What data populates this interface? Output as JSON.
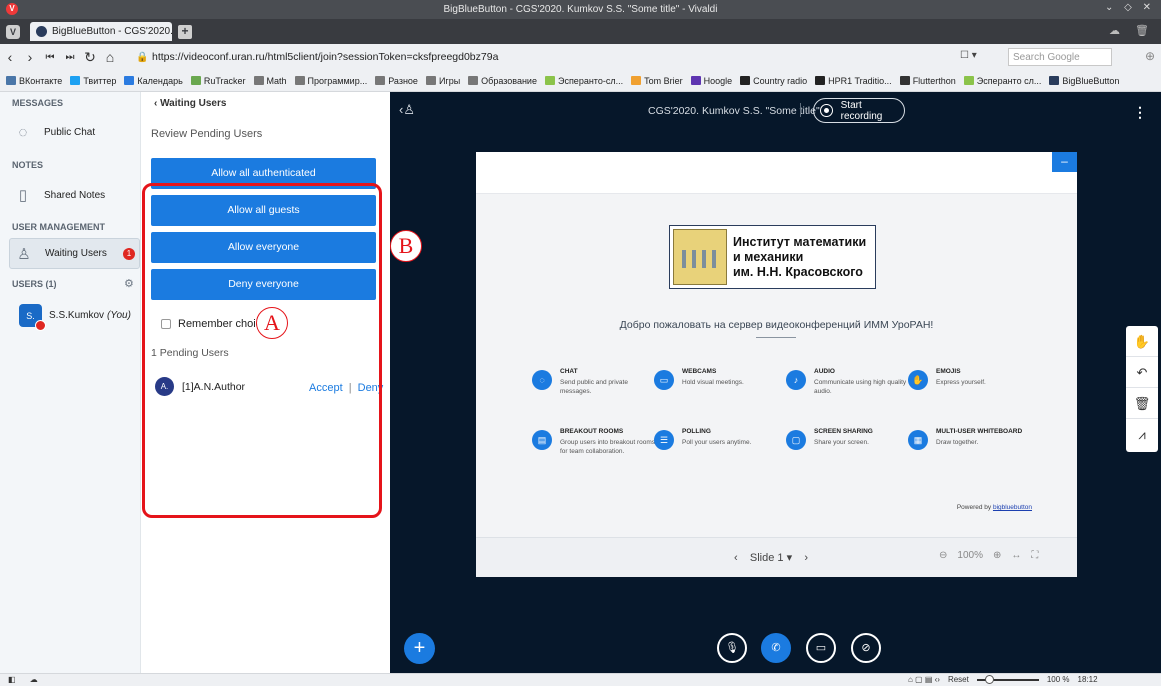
{
  "window": {
    "title": "BigBlueButton - CGS'2020. Kumkov S.S. \"Some title\" - Vivaldi"
  },
  "tab": {
    "label": "BigBlueButton - CGS'2020."
  },
  "address": {
    "url": "https://videoconf.uran.ru/html5client/join?sessionToken=cksfpreegd0bz79a",
    "search_placeholder": "Search Google"
  },
  "bookmarks": [
    {
      "label": "ВКонтакте",
      "color": "#4a76a8"
    },
    {
      "label": "Твиттер",
      "color": "#1da1f2"
    },
    {
      "label": "Календарь",
      "color": "#2b7be0"
    },
    {
      "label": "RuTracker",
      "color": "#6aa84f"
    },
    {
      "label": "Math",
      "color": "#777777"
    },
    {
      "label": "Программир...",
      "color": "#777777"
    },
    {
      "label": "Разное",
      "color": "#777777"
    },
    {
      "label": "Игры",
      "color": "#777777"
    },
    {
      "label": "Образование",
      "color": "#777777"
    },
    {
      "label": "Эсперанто-сл...",
      "color": "#8bc34a"
    },
    {
      "label": "Tom Brier",
      "color": "#f0a030"
    },
    {
      "label": "Hoogle",
      "color": "#5e35b1"
    },
    {
      "label": "Country radio",
      "color": "#222222"
    },
    {
      "label": "HPR1 Traditio...",
      "color": "#222222"
    },
    {
      "label": "Flutterthon",
      "color": "#333333"
    },
    {
      "label": "Эсперанто сл...",
      "color": "#8bc34a"
    },
    {
      "label": "BigBlueButton",
      "color": "#2a3c5c"
    }
  ],
  "sidebar": {
    "messages_heading": "MESSAGES",
    "public_chat": "Public Chat",
    "notes_heading": "NOTES",
    "shared_notes": "Shared Notes",
    "user_mgmt_heading": "USER MANAGEMENT",
    "waiting_users": "Waiting Users",
    "waiting_badge": "1",
    "users_heading": "USERS (1)",
    "user": {
      "initials": "S.",
      "name": "S.S.Kumkov",
      "you": "(You)"
    }
  },
  "waiting_panel": {
    "back_label": "Waiting Users",
    "review": "Review Pending Users",
    "buttons": [
      "Allow all authenticated",
      "Allow all guests",
      "Allow everyone",
      "Deny everyone"
    ],
    "remember": "Remember choice",
    "pending_count": "1 Pending Users",
    "pending_user": {
      "initials": "A.",
      "name": "[1]A.N.Author"
    },
    "accept": "Accept",
    "separator": "|",
    "deny": "Deny"
  },
  "annotations": {
    "a": "A",
    "b": "B",
    "color": "#e5141a"
  },
  "main": {
    "title": "CGS'2020. Kumkov S.S. \"Some title\"",
    "record": "Start recording",
    "logo_lines": [
      "Институт математики",
      "и механики",
      "им. Н.Н. Красовского"
    ],
    "welcome": "Добро пожаловать на сервер видеоконференций ИММ УроРАН!",
    "features": [
      {
        "title": "CHAT",
        "desc": "Send public and private messages."
      },
      {
        "title": "WEBCAMS",
        "desc": "Hold visual meetings."
      },
      {
        "title": "AUDIO",
        "desc": "Communicate using high quality audio."
      },
      {
        "title": "EMOJIS",
        "desc": "Express yourself."
      },
      {
        "title": "BREAKOUT ROOMS",
        "desc": "Group users into breakout rooms for team collaboration."
      },
      {
        "title": "POLLING",
        "desc": "Poll your users anytime."
      },
      {
        "title": "SCREEN SHARING",
        "desc": "Share your screen."
      },
      {
        "title": "MULTI-USER WHITEBOARD",
        "desc": "Draw together."
      }
    ],
    "powered_prefix": "Powered by",
    "powered_link": "bigbluebutton",
    "slide_label": "Slide 1",
    "zoom": "100%"
  },
  "statusbar": {
    "reset": "Reset",
    "zoom": "100 %",
    "time": "18:12"
  },
  "accent": "#1b7be0"
}
